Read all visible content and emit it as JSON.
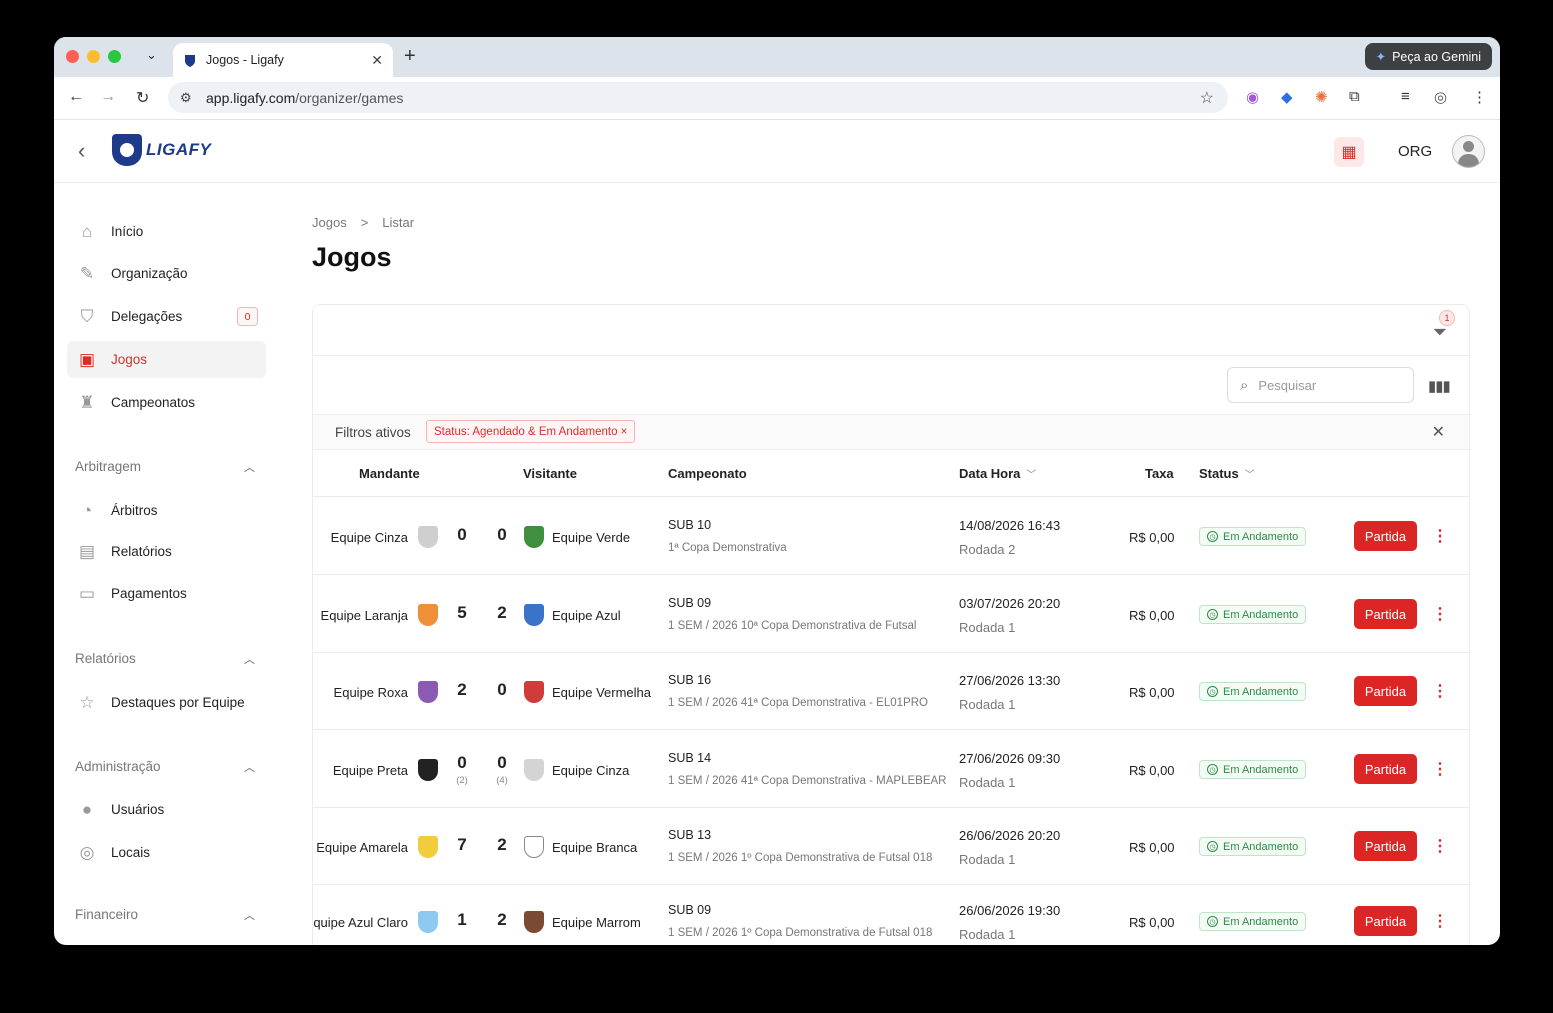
{
  "browser": {
    "tab_title": "Jogos - Ligafy",
    "url_host": "app.ligafy.com",
    "url_path": "/organizer/games",
    "gemini_label": "Peça ao Gemini"
  },
  "header": {
    "logo_text": "LIGAFY",
    "org_label": "ORG"
  },
  "sidebar": {
    "items": [
      {
        "label": "Início",
        "icon": "home-icon"
      },
      {
        "label": "Organização",
        "icon": "edit-icon"
      },
      {
        "label": "Delegações",
        "icon": "shield-icon",
        "badge": "0"
      },
      {
        "label": "Jogos",
        "icon": "calendar-icon",
        "active": true
      },
      {
        "label": "Campeonatos",
        "icon": "trophy-icon"
      }
    ],
    "sections": [
      {
        "title": "Arbitragem",
        "items": [
          {
            "label": "Árbitros",
            "icon": "whistle-icon"
          },
          {
            "label": "Relatórios",
            "icon": "report-icon"
          },
          {
            "label": "Pagamentos",
            "icon": "payment-icon"
          }
        ]
      },
      {
        "title": "Relatórios",
        "items": [
          {
            "label": "Destaques por Equipe",
            "icon": "star-icon"
          }
        ]
      },
      {
        "title": "Administração",
        "items": [
          {
            "label": "Usuários",
            "icon": "users-icon"
          },
          {
            "label": "Locais",
            "icon": "location-icon"
          }
        ]
      },
      {
        "title": "Financeiro",
        "items": []
      }
    ]
  },
  "breadcrumb": {
    "first": "Jogos",
    "sep": ">",
    "second": "Listar"
  },
  "page_title": "Jogos",
  "toolbar": {
    "filter_count": "1",
    "search_placeholder": "Pesquisar",
    "active_filters_label": "Filtros ativos",
    "active_filter_chip": "Status: Agendado & Em Andamento ×"
  },
  "table": {
    "headers": {
      "home": "Mandante",
      "away": "Visitante",
      "championship": "Campeonato",
      "datetime": "Data Hora",
      "fee": "Taxa",
      "status": "Status"
    },
    "rows": [
      {
        "home": "Equipe Cinza",
        "home_color": "#cfcfcf",
        "home_score": "0",
        "away_score": "0",
        "home_pen": "",
        "away_pen": "",
        "away": "Equipe Verde",
        "away_color": "#3f8f3f",
        "champ": "SUB 10",
        "champ_sub": "1ª Copa Demonstrativa",
        "date": "14/08/2026 16:43",
        "round": "Rodada 2",
        "fee": "R$ 0,00",
        "status": "Em Andamento",
        "action": "Partida"
      },
      {
        "home": "Equipe Laranja",
        "home_color": "#f0913a",
        "home_score": "5",
        "away_score": "2",
        "home_pen": "",
        "away_pen": "",
        "away": "Equipe Azul",
        "away_color": "#3a73c9",
        "champ": "SUB 09",
        "champ_sub": "1 SEM / 2026 10ª Copa Demonstrativa de Futsal",
        "date": "03/07/2026 20:20",
        "round": "Rodada 1",
        "fee": "R$ 0,00",
        "status": "Em Andamento",
        "action": "Partida"
      },
      {
        "home": "Equipe Roxa",
        "home_color": "#8a5ab5",
        "home_score": "2",
        "away_score": "0",
        "home_pen": "",
        "away_pen": "",
        "away": "Equipe Vermelha",
        "away_color": "#d03b3b",
        "champ": "SUB 16",
        "champ_sub": "1 SEM / 2026 41ª Copa Demonstrativa - EL01PRO",
        "date": "27/06/2026 13:30",
        "round": "Rodada 1",
        "fee": "R$ 0,00",
        "status": "Em Andamento",
        "action": "Partida"
      },
      {
        "home": "Equipe Preta",
        "home_color": "#222222",
        "home_score": "0",
        "away_score": "0",
        "home_pen": "(2)",
        "away_pen": "(4)",
        "away": "Equipe Cinza",
        "away_color": "#d4d4d4",
        "champ": "SUB 14",
        "champ_sub": "1 SEM / 2026 41ª Copa Demonstrativa - MAPLEBEAR",
        "date": "27/06/2026 09:30",
        "round": "Rodada 1",
        "fee": "R$ 0,00",
        "status": "Em Andamento",
        "action": "Partida"
      },
      {
        "home": "Equipe Amarela",
        "home_color": "#f2cc3c",
        "home_score": "7",
        "away_score": "2",
        "home_pen": "",
        "away_pen": "",
        "away": "Equipe Branca",
        "away_color": "#ffffff",
        "champ": "SUB 13",
        "champ_sub": "1 SEM / 2026 1º Copa Demonstrativa de Futsal 018",
        "date": "26/06/2026 20:20",
        "round": "Rodada 1",
        "fee": "R$ 0,00",
        "status": "Em Andamento",
        "action": "Partida"
      },
      {
        "home": "Equipe Azul Claro",
        "home_color": "#8ec9f0",
        "home_score": "1",
        "away_score": "2",
        "home_pen": "",
        "away_pen": "",
        "away": "Equipe Marrom",
        "away_color": "#7a4a33",
        "champ": "SUB 09",
        "champ_sub": "1 SEM / 2026 1º Copa Demonstrativa de Futsal 018",
        "date": "26/06/2026 19:30",
        "round": "Rodada 1",
        "fee": "R$ 0,00",
        "status": "Em Andamento",
        "action": "Partida"
      }
    ]
  },
  "colors": {
    "accent": "#dc2626",
    "status_green": "#2e8b47"
  }
}
